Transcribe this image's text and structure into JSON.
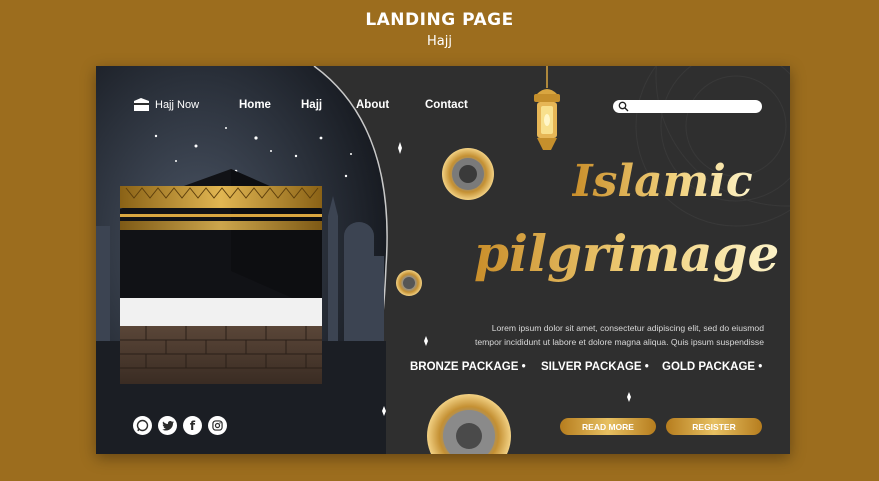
{
  "outer": {
    "title": "LANDING PAGE",
    "subtitle": "Hajj"
  },
  "header": {
    "logo_label": "Hajj Now",
    "nav": [
      "Home",
      "Hajj",
      "About",
      "Contact"
    ],
    "search_placeholder": ""
  },
  "hero": {
    "headline_line1": "Islamic",
    "headline_line2": "pilgrimage",
    "body_line1": "Lorem ipsum dolor sit amet, consectetur  adipiscing elit, sed do eiusmod",
    "body_line2": "tempor incididunt ut labore et dolore magna aliqua. Quis ipsum suspendisse"
  },
  "packages": [
    "BRONZE PACKAGE •",
    "SILVER PACKAGE •",
    "GOLD PACKAGE •"
  ],
  "buttons": {
    "read_more": "READ MORE",
    "register": "REGISTER"
  },
  "social_icons": [
    "whatsapp-icon",
    "twitter-icon",
    "facebook-icon",
    "instagram-icon"
  ],
  "colors": {
    "background": "#9c6d1e",
    "panel": "#2f2f2f",
    "gold": "#d9a640"
  }
}
